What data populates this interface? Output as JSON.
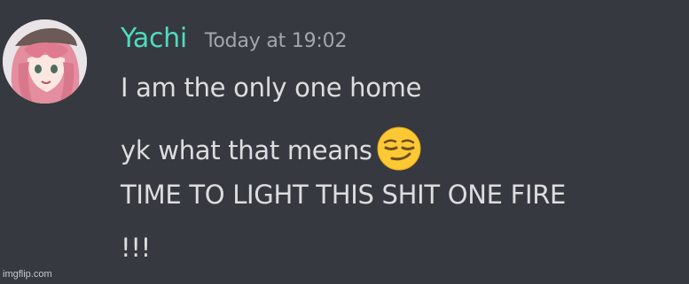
{
  "message": {
    "username": "Yachi",
    "timestamp": "Today at 19:02",
    "lines": [
      "I am the only one home",
      "yk what that means",
      "TIME TO LIGHT THIS SHIT ONE FIRE",
      "!!!"
    ],
    "emoji": "smirking-face-emoji"
  },
  "colors": {
    "background": "#36393f",
    "username": "#4fdcc0",
    "text": "#dcddde",
    "timestamp": "#a3a6aa"
  },
  "watermark": "imgflip.com"
}
